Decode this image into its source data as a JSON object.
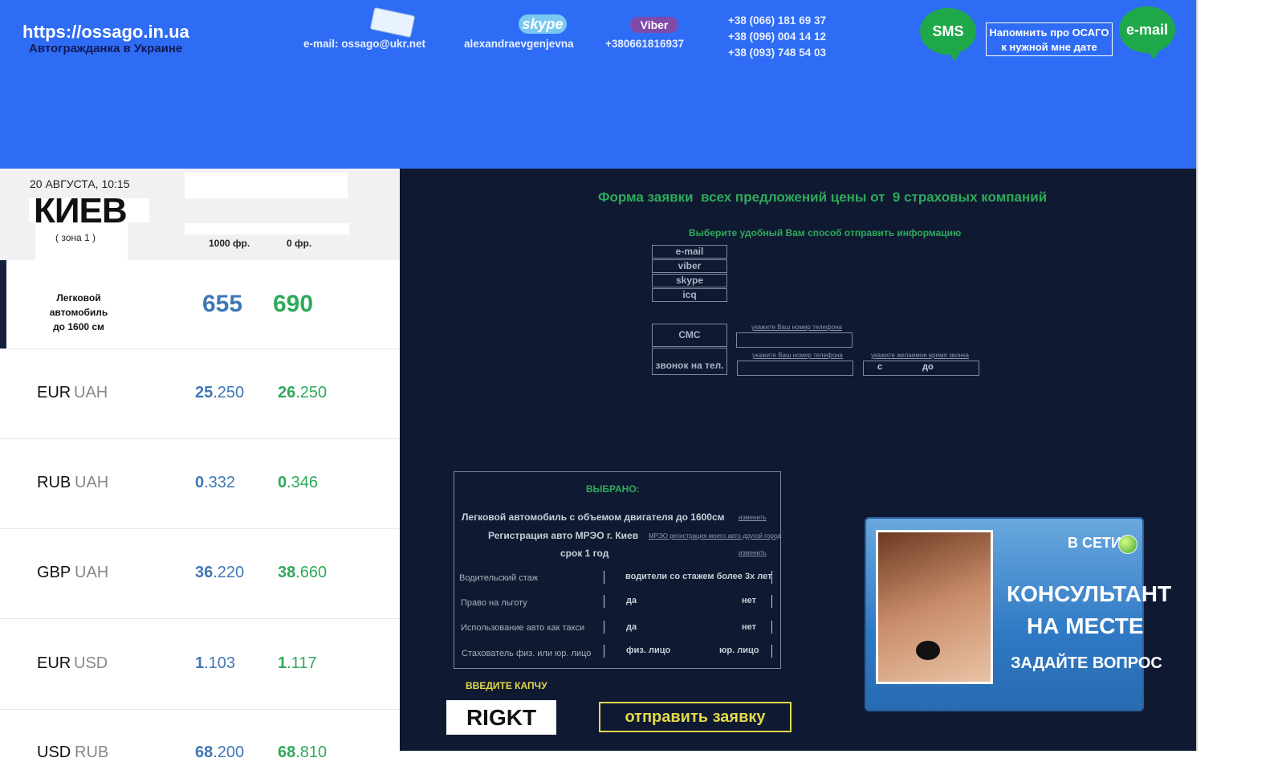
{
  "header": {
    "site_url": "https://ossago.in.ua",
    "tagline": "Автогражданка в Украине",
    "email": "e-mail: ossago@ukr.net",
    "skype_logo": "skype",
    "skype_name": "alexandraevgenjevna",
    "viber_logo": "Viber",
    "viber_number": "+380661816937",
    "phones": [
      "+38 (066) 181 69 37",
      "+38 (096) 004 14 12",
      "+38 (093) 748 54 03"
    ],
    "sms_label": "SMS",
    "remind_line1": "Напомнить про ОСАГО",
    "remind_line2": "к нужной мне дате",
    "email_bubble": "e-mail",
    "colors": {
      "header_bg": "#2f6cf5",
      "bubble": "#1fa84a"
    }
  },
  "rates_panel": {
    "datetime": "20 АВГУСТА, 10:15",
    "city": "КИЕВ",
    "zone": "( зона 1 )",
    "col1": "1000 фр.",
    "col2": "0 фр.",
    "car_line1": "Легковой автомобиль",
    "car_line2": "до 1600 см",
    "price1": "655",
    "price2": "690",
    "rows": [
      {
        "cur": "EUR",
        "base": "UAH",
        "buy_int": "25",
        "buy_frac": ".250",
        "sell_int": "26",
        "sell_frac": ".250"
      },
      {
        "cur": "RUB",
        "base": "UAH",
        "buy_int": "0",
        "buy_frac": ".332",
        "sell_int": "0",
        "sell_frac": ".346"
      },
      {
        "cur": "GBP",
        "base": "UAH",
        "buy_int": "36",
        "buy_frac": ".220",
        "sell_int": "38",
        "sell_frac": ".660"
      },
      {
        "cur": "EUR",
        "base": "USD",
        "buy_int": "1",
        "buy_frac": ".103",
        "sell_int": "1",
        "sell_frac": ".117"
      },
      {
        "cur": "USD",
        "base": "RUB",
        "buy_int": "68",
        "buy_frac": ".200",
        "sell_int": "68",
        "sell_frac": ".810"
      }
    ],
    "colors": {
      "buy": "#3f77b5",
      "sell": "#2faa5a"
    }
  },
  "form": {
    "title": "Форма заявки  всех предложений цены от  9 страховых компаний",
    "choose_method": "Выберите удобный Вам способ отправить  информацию",
    "methods": [
      "e-mail",
      "viber",
      "skype",
      "icq"
    ],
    "sms_label": "СМС",
    "call_label": "звонок на тел.",
    "phone_hint": "укажите Ваш номер телефона",
    "time_hint": "укажите желаемое время звонка",
    "from_label": "с",
    "to_label": "до"
  },
  "selected": {
    "heading": "ВЫБРАНО:",
    "car": "Легковой автомобиль с объемом двигателя до 1600см",
    "change": "изменить",
    "registration": "Регистрация авто МРЭО  г. Киев",
    "other_city": "МРЭО регистрация моего авто другой город",
    "term": "срок 1 год",
    "term_change": "изменить",
    "fields": [
      {
        "label": "Водительский стаж",
        "value_left": "водители со стажем более 3х лет",
        "value_right": ""
      },
      {
        "label": "Право на льготу",
        "value_left": "да",
        "value_right": "нет"
      },
      {
        "label": "Использование авто как такси",
        "value_left": "да",
        "value_right": "нет"
      },
      {
        "label": "Стахователь  физ. или юр. лицо",
        "value_left": "физ. лицо",
        "value_right": "юр. лицо"
      }
    ]
  },
  "captcha": {
    "label": "ВВЕДИТЕ КАПЧУ",
    "code": "RIGKT"
  },
  "submit_label": "отправить заявку",
  "banner": {
    "online": "В СЕТИ",
    "line1": "КОНСУЛЬТАНТ",
    "line2": "НА МЕСТЕ",
    "ask": "ЗАДАЙТЕ ВОПРОС"
  }
}
